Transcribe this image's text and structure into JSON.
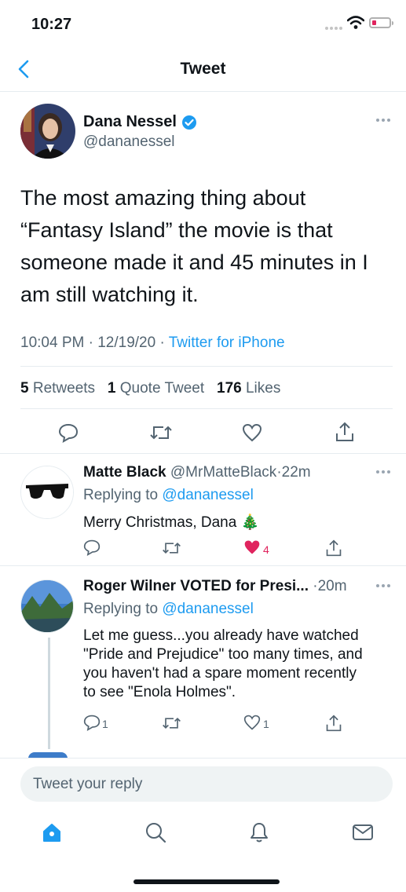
{
  "status_bar": {
    "time": "10:27"
  },
  "header": {
    "title": "Tweet"
  },
  "tweet": {
    "author_name": "Dana Nessel",
    "author_handle": "@dananessel",
    "text_lines": [
      "The most amazing thing about",
      "“Fantasy Island” the movie is that",
      "someone made it and 45 minutes in I",
      "am still watching it."
    ],
    "time": "10:04 PM",
    "date": "12/19/20",
    "source": "Twitter for iPhone",
    "separator": "·",
    "retweets_count": "5",
    "retweets_label": "Retweets",
    "quotes_count": "1",
    "quotes_label": "Quote Tweet",
    "likes_count": "176",
    "likes_label": "Likes"
  },
  "replies": [
    {
      "name": "Matte Black",
      "handle": "@MrMatteBlack",
      "time": "22m",
      "replying_label": "Replying to",
      "replying_to": "@dananessel",
      "text": "Merry Christmas, Dana 🎄",
      "like_count": "4",
      "liked": true
    },
    {
      "name": "Roger Wilner VOTED for Presi...",
      "time": "20m",
      "replying_label": "Replying to",
      "replying_to": "@dananessel",
      "text_lines": [
        "Let me guess...you already have watched",
        "\"Pride and Prejudice\" too many times, and",
        "you haven't had a spare moment recently",
        "to see \"Enola Holmes\"."
      ],
      "reply_count": "1",
      "like_count": "1"
    }
  ],
  "compose": {
    "placeholder": "Tweet your reply"
  },
  "tabs": [
    {
      "icon": "home-icon",
      "active": true
    },
    {
      "icon": "search-icon"
    },
    {
      "icon": "notifications-bell-icon"
    },
    {
      "icon": "messages-envelope-icon"
    }
  ],
  "colors": {
    "accent": "#1d9bf0",
    "like_red": "#e0245e",
    "text": "#0f1419",
    "secondary": "#536471"
  }
}
